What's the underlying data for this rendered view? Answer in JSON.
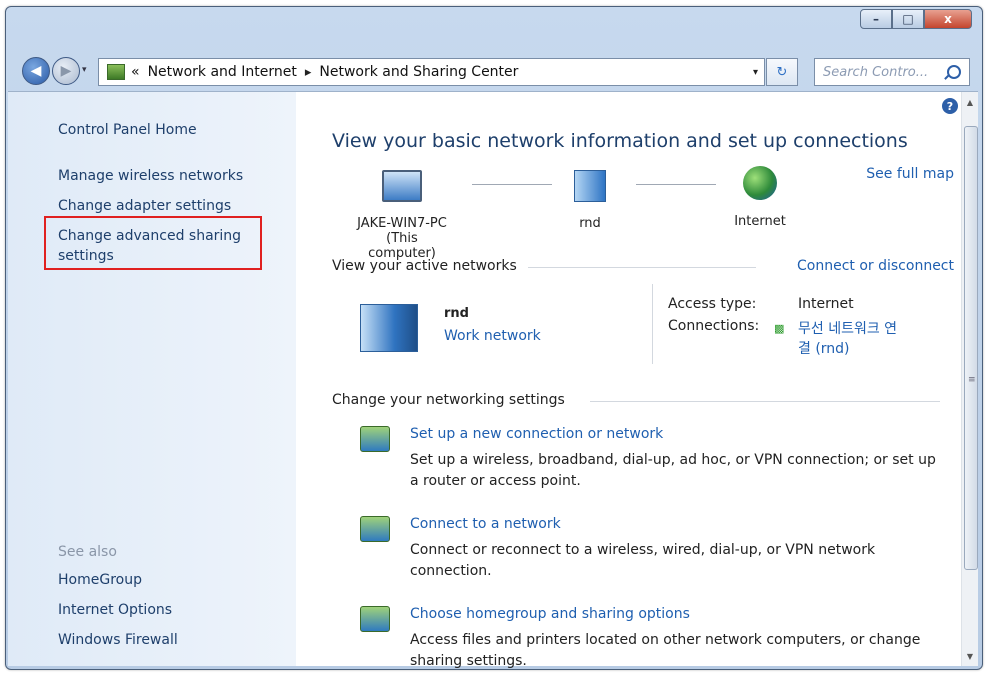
{
  "window": {
    "buttons": {
      "minimize": "–",
      "maximize": "□",
      "close": "x"
    }
  },
  "address_bar": {
    "recent_glyph": "▾",
    "overflow": "«",
    "breadcrumb": [
      "Network and Internet",
      "Network and Sharing Center"
    ],
    "separator": "▸",
    "dropdown_glyph": "▾",
    "refresh_glyph": "↻",
    "search_placeholder": "Search Contro..."
  },
  "sidebar": {
    "home": "Control Panel Home",
    "links": [
      "Manage wireless networks",
      "Change adapter settings"
    ],
    "highlighted_link": [
      "Change advanced sharing",
      "settings"
    ],
    "see_also_label": "See also",
    "see_also": [
      "HomeGroup",
      "Internet Options",
      "Windows Firewall"
    ]
  },
  "main": {
    "help_glyph": "?",
    "title": "View your basic network information and set up connections",
    "see_full_map": "See full map",
    "map": {
      "computer": [
        "JAKE-WIN7-PC",
        "(This computer)"
      ],
      "network": "rnd",
      "internet": "Internet"
    },
    "active_networks": {
      "heading": "View your active networks",
      "connect_link": "Connect or disconnect",
      "network_name": "rnd",
      "network_type": "Work network",
      "access_type_label": "Access type:",
      "access_type_value": "Internet",
      "connections_label": "Connections:",
      "connection_value": [
        "무선 네트워크 연",
        "결 (rnd)"
      ]
    },
    "settings": {
      "heading": "Change your networking settings",
      "tasks": [
        {
          "title": "Set up a new connection or network",
          "desc": "Set up a wireless, broadband, dial-up, ad hoc, or VPN connection; or set up a router or access point.",
          "icon": "new-connection-icon"
        },
        {
          "title": "Connect to a network",
          "desc": "Connect or reconnect to a wireless, wired, dial-up, or VPN network connection.",
          "icon": "connect-network-icon"
        },
        {
          "title": "Choose homegroup and sharing options",
          "desc": "Access files and printers located on other network computers, or change sharing settings.",
          "icon": "homegroup-icon"
        }
      ]
    }
  },
  "scrollbar": {
    "up": "▲",
    "down": "▼",
    "grip": "≡"
  },
  "colors": {
    "link": "#1f5fb0",
    "highlight_border": "#e02020",
    "sidebar_text": "#1e3f6b"
  }
}
